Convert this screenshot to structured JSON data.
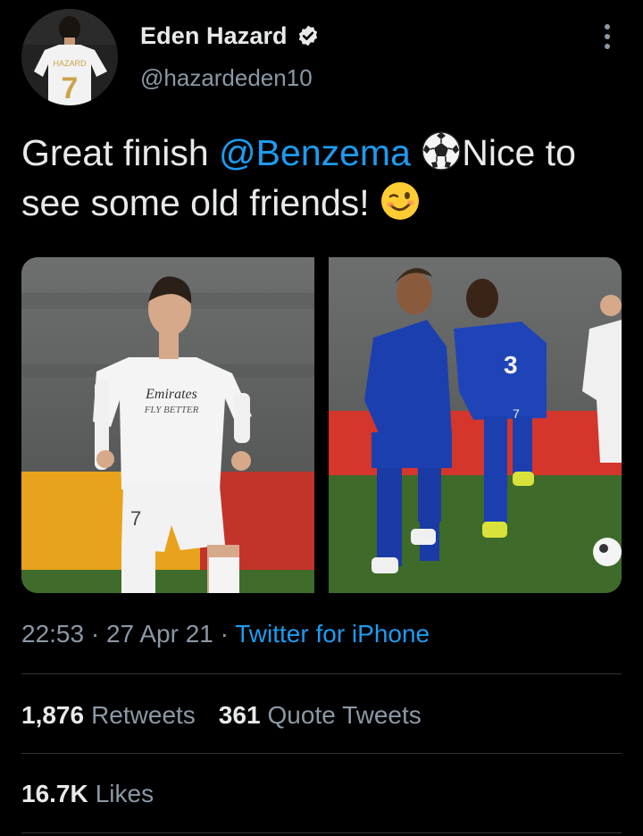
{
  "author": {
    "display_name": "Eden Hazard",
    "handle": "@hazardeden10",
    "verified": true,
    "avatar_icon": "profile-photo"
  },
  "tweet": {
    "text_part1": "Great finish ",
    "mention": "@Benzema",
    "text_part2": "Nice to",
    "text_line2": "see some old friends! ",
    "emoji1": "soccer-ball-icon",
    "emoji2": "winking-face-icon"
  },
  "media": [
    {
      "description_icon": "photo-hazard"
    },
    {
      "description_icon": "photo-chelsea-players"
    }
  ],
  "meta": {
    "time": "22:53",
    "sep1": " · ",
    "date": "27 Apr 21",
    "sep2": " · ",
    "source": "Twitter for iPhone"
  },
  "stats": {
    "retweets_count": "1,876",
    "retweets_label": "Retweets",
    "quote_count": "361",
    "quote_label": "Quote Tweets",
    "likes_count": "16.7K",
    "likes_label": "Likes"
  },
  "colors": {
    "background": "#000000",
    "text": "#e7e9ea",
    "secondary": "#8b98a5",
    "link": "#1d9bf0",
    "divider": "#2f3336"
  }
}
